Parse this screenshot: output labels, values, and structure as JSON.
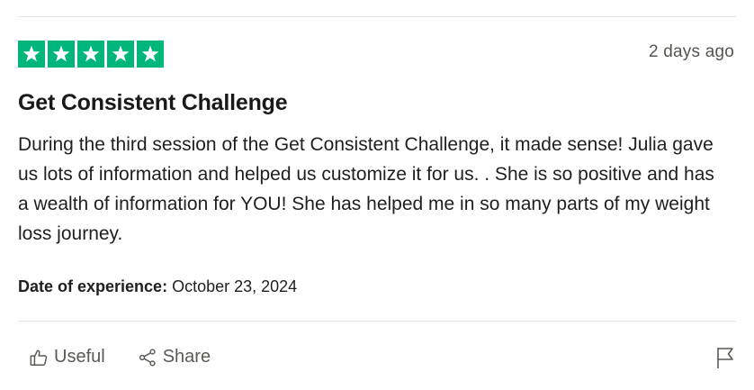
{
  "review": {
    "rating": 5,
    "rating_max": 5,
    "star_color": "#00b67a",
    "date_ago": "2 days ago",
    "title": "Get Consistent Challenge",
    "body": "During the third session of the Get Consistent Challenge, it made sense! Julia gave us lots of information and helped us customize it for us. . She is so positive and has a wealth of information for YOU! She has helped me in so many parts of my weight loss journey.",
    "experience_label": "Date of experience:",
    "experience_date": "October 23, 2024"
  },
  "actions": {
    "useful_label": "Useful",
    "useful_icon": "thumbs-up-icon",
    "share_label": "Share",
    "share_icon": "share-icon",
    "flag_icon": "flag-icon"
  }
}
